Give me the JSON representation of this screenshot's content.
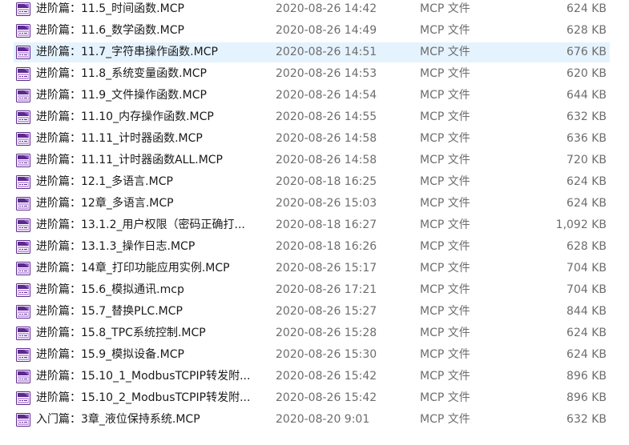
{
  "icon": {
    "name": "mcp-file-icon",
    "frame_color": "#5a2a8c",
    "accent_color": "#9c58d4"
  },
  "selected_row_color": "#e5f3ff",
  "files": [
    {
      "name": "进阶篇：11.5_时间函数.MCP",
      "date": "2020-08-26 14:42",
      "type": "MCP 文件",
      "size": "624 KB"
    },
    {
      "name": "进阶篇：11.6_数学函数.MCP",
      "date": "2020-08-26 14:49",
      "type": "MCP 文件",
      "size": "628 KB"
    },
    {
      "name": "进阶篇：11.7_字符串操作函数.MCP",
      "date": "2020-08-26 14:51",
      "type": "MCP 文件",
      "size": "676 KB",
      "selected": true
    },
    {
      "name": "进阶篇：11.8_系统变量函数.MCP",
      "date": "2020-08-26 14:53",
      "type": "MCP 文件",
      "size": "620 KB"
    },
    {
      "name": "进阶篇：11.9_文件操作函数.MCP",
      "date": "2020-08-26 14:54",
      "type": "MCP 文件",
      "size": "644 KB"
    },
    {
      "name": "进阶篇：11.10_内存操作函数.MCP",
      "date": "2020-08-26 14:55",
      "type": "MCP 文件",
      "size": "632 KB"
    },
    {
      "name": "进阶篇：11.11_计时器函数.MCP",
      "date": "2020-08-26 14:58",
      "type": "MCP 文件",
      "size": "636 KB"
    },
    {
      "name": "进阶篇：11.11_计时器函数ALL.MCP",
      "date": "2020-08-26 14:58",
      "type": "MCP 文件",
      "size": "720 KB"
    },
    {
      "name": "进阶篇：12.1_多语言.MCP",
      "date": "2020-08-18 16:25",
      "type": "MCP 文件",
      "size": "624 KB"
    },
    {
      "name": "进阶篇：12章_多语言.MCP",
      "date": "2020-08-26 15:03",
      "type": "MCP 文件",
      "size": "624 KB"
    },
    {
      "name": "进阶篇：13.1.2_用户权限（密码正确打...",
      "date": "2020-08-18 16:27",
      "type": "MCP 文件",
      "size": "1,092 KB"
    },
    {
      "name": "进阶篇：13.1.3_操作日志.MCP",
      "date": "2020-08-18 16:26",
      "type": "MCP 文件",
      "size": "628 KB"
    },
    {
      "name": "进阶篇：14章_打印功能应用实例.MCP",
      "date": "2020-08-26 15:17",
      "type": "MCP 文件",
      "size": "704 KB"
    },
    {
      "name": "进阶篇：15.6_模拟通讯.mcp",
      "date": "2020-08-26 17:21",
      "type": "MCP 文件",
      "size": "704 KB"
    },
    {
      "name": "进阶篇：15.7_替换PLC.MCP",
      "date": "2020-08-26 15:27",
      "type": "MCP 文件",
      "size": "844 KB"
    },
    {
      "name": "进阶篇：15.8_TPC系统控制.MCP",
      "date": "2020-08-26 15:28",
      "type": "MCP 文件",
      "size": "624 KB"
    },
    {
      "name": "进阶篇：15.9_模拟设备.MCP",
      "date": "2020-08-26 15:30",
      "type": "MCP 文件",
      "size": "624 KB"
    },
    {
      "name": "进阶篇：15.10_1_ModbusTCPIP转发附...",
      "date": "2020-08-26 15:42",
      "type": "MCP 文件",
      "size": "896 KB"
    },
    {
      "name": "进阶篇：15.10_2_ModbusTCPIP转发附...",
      "date": "2020-08-26 15:42",
      "type": "MCP 文件",
      "size": "896 KB"
    },
    {
      "name": "入门篇：3章_液位保持系统.MCP",
      "date": "2020-08-20 9:01",
      "type": "MCP 文件",
      "size": "632 KB"
    }
  ]
}
